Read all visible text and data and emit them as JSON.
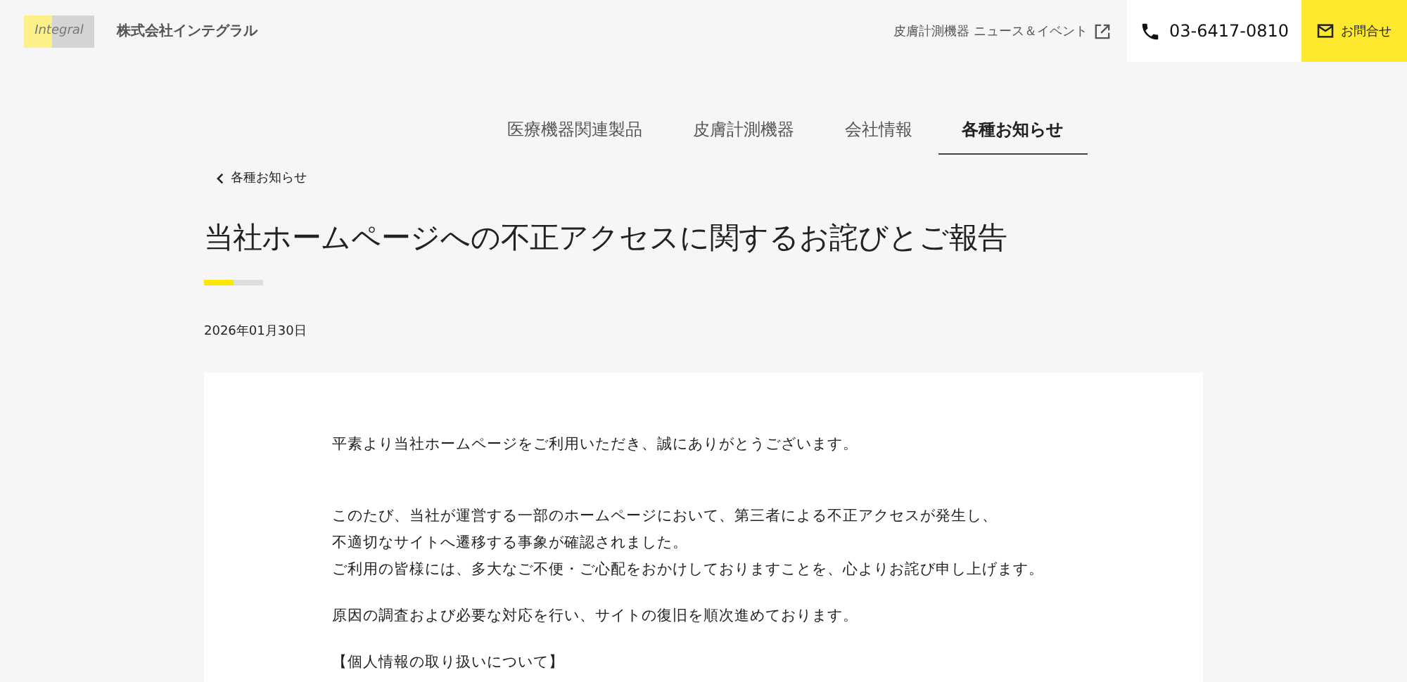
{
  "header": {
    "logo": "Integral",
    "company": "株式会社インテグラル",
    "news_link": "皮膚計測機器 ニュース＆イベント",
    "phone": "03-6417-0810",
    "contact": "お問合せ"
  },
  "nav": [
    {
      "label": "医療機器関連製品",
      "selected": false
    },
    {
      "label": "皮膚計測機器",
      "selected": false
    },
    {
      "label": "会社情報",
      "selected": false
    },
    {
      "label": "各種お知らせ",
      "selected": true
    }
  ],
  "back_link": "各種お知らせ",
  "title": "当社ホームページへの不正アクセスに関するお詫びとご報告",
  "date": "2026年01月30日",
  "paragraphs": [
    [
      "平素より当社ホームページをご利用いただき、誠にありがとうございます。"
    ],
    [
      "このたび、当社が運営する一部のホームページにおいて、第三者による不正アクセスが発生し、",
      "不適切なサイトへ遷移する事象が確認されました。",
      "ご利用の皆様には、多大なご不便・ご心配をおかけしておりますことを、心よりお詫び申し上げます。"
    ],
    [
      "原因の調査および必要な対応を行い、サイトの復旧を順次進めております。"
    ],
    [
      "【個人情報の取り扱いについて】"
    ]
  ]
}
